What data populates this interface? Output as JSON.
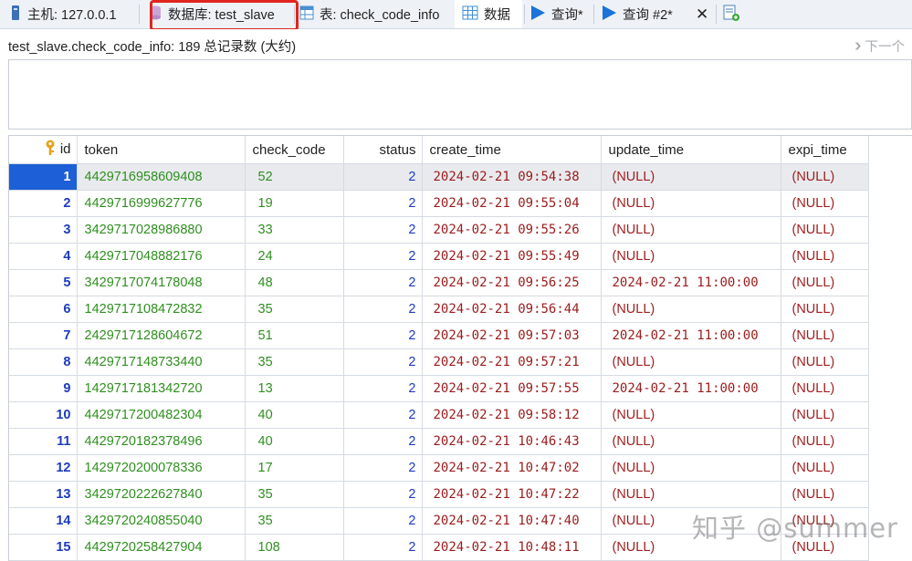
{
  "tabs": [
    {
      "label": "主机: 127.0.0.1",
      "icon": "server-icon"
    },
    {
      "label": "数据库: test_slave",
      "icon": "database-icon"
    },
    {
      "label": "表: check_code_info",
      "icon": "table-icon"
    },
    {
      "label": "数据",
      "icon": "grid-data-icon"
    },
    {
      "label": "查询*",
      "icon": "play-icon"
    },
    {
      "label": "查询 #2*",
      "icon": "play-icon"
    },
    {
      "label": "✕",
      "icon": "close-icon"
    },
    {
      "label": "",
      "icon": "new-query-icon"
    }
  ],
  "info": {
    "text": "test_slave.check_code_info: 189 总记录数 (大约)",
    "next_label": "下一个"
  },
  "columns": [
    "id",
    "token",
    "check_code",
    "status",
    "create_time",
    "update_time",
    "expi_time"
  ],
  "rows": [
    {
      "id": "1",
      "token": "4429716958609408",
      "check_code": "52",
      "status": "2",
      "create_time": "2024-02-21 09:54:38",
      "update_time": "(NULL)",
      "expi_time": "(NULL)"
    },
    {
      "id": "2",
      "token": "4429716999627776",
      "check_code": "19",
      "status": "2",
      "create_time": "2024-02-21 09:55:04",
      "update_time": "(NULL)",
      "expi_time": "(NULL)"
    },
    {
      "id": "3",
      "token": "3429717028986880",
      "check_code": "33",
      "status": "2",
      "create_time": "2024-02-21 09:55:26",
      "update_time": "(NULL)",
      "expi_time": "(NULL)"
    },
    {
      "id": "4",
      "token": "4429717048882176",
      "check_code": "24",
      "status": "2",
      "create_time": "2024-02-21 09:55:49",
      "update_time": "(NULL)",
      "expi_time": "(NULL)"
    },
    {
      "id": "5",
      "token": "3429717074178048",
      "check_code": "48",
      "status": "2",
      "create_time": "2024-02-21 09:56:25",
      "update_time": "2024-02-21 11:00:00",
      "expi_time": "(NULL)"
    },
    {
      "id": "6",
      "token": "1429717108472832",
      "check_code": "35",
      "status": "2",
      "create_time": "2024-02-21 09:56:44",
      "update_time": "(NULL)",
      "expi_time": "(NULL)"
    },
    {
      "id": "7",
      "token": "2429717128604672",
      "check_code": "51",
      "status": "2",
      "create_time": "2024-02-21 09:57:03",
      "update_time": "2024-02-21 11:00:00",
      "expi_time": "(NULL)"
    },
    {
      "id": "8",
      "token": "4429717148733440",
      "check_code": "35",
      "status": "2",
      "create_time": "2024-02-21 09:57:21",
      "update_time": "(NULL)",
      "expi_time": "(NULL)"
    },
    {
      "id": "9",
      "token": "1429717181342720",
      "check_code": "13",
      "status": "2",
      "create_time": "2024-02-21 09:57:55",
      "update_time": "2024-02-21 11:00:00",
      "expi_time": "(NULL)"
    },
    {
      "id": "10",
      "token": "4429717200482304",
      "check_code": "40",
      "status": "2",
      "create_time": "2024-02-21 09:58:12",
      "update_time": "(NULL)",
      "expi_time": "(NULL)"
    },
    {
      "id": "11",
      "token": "4429720182378496",
      "check_code": "40",
      "status": "2",
      "create_time": "2024-02-21 10:46:43",
      "update_time": "(NULL)",
      "expi_time": "(NULL)"
    },
    {
      "id": "12",
      "token": "1429720200078336",
      "check_code": "17",
      "status": "2",
      "create_time": "2024-02-21 10:47:02",
      "update_time": "(NULL)",
      "expi_time": "(NULL)"
    },
    {
      "id": "13",
      "token": "3429720222627840",
      "check_code": "35",
      "status": "2",
      "create_time": "2024-02-21 10:47:22",
      "update_time": "(NULL)",
      "expi_time": "(NULL)"
    },
    {
      "id": "14",
      "token": "3429720240855040",
      "check_code": "35",
      "status": "2",
      "create_time": "2024-02-21 10:47:40",
      "update_time": "(NULL)",
      "expi_time": "(NULL)"
    },
    {
      "id": "15",
      "token": "4429720258427904",
      "check_code": "108",
      "status": "2",
      "create_time": "2024-02-21 10:48:11",
      "update_time": "(NULL)",
      "expi_time": "(NULL)"
    }
  ],
  "watermark": "知乎 @summer",
  "colors": {
    "highlight": "#e0251f",
    "selected_id": "#1d5fd6",
    "token": "#2f8f1f",
    "date": "#9b1b1b",
    "id": "#1d3bbd"
  }
}
